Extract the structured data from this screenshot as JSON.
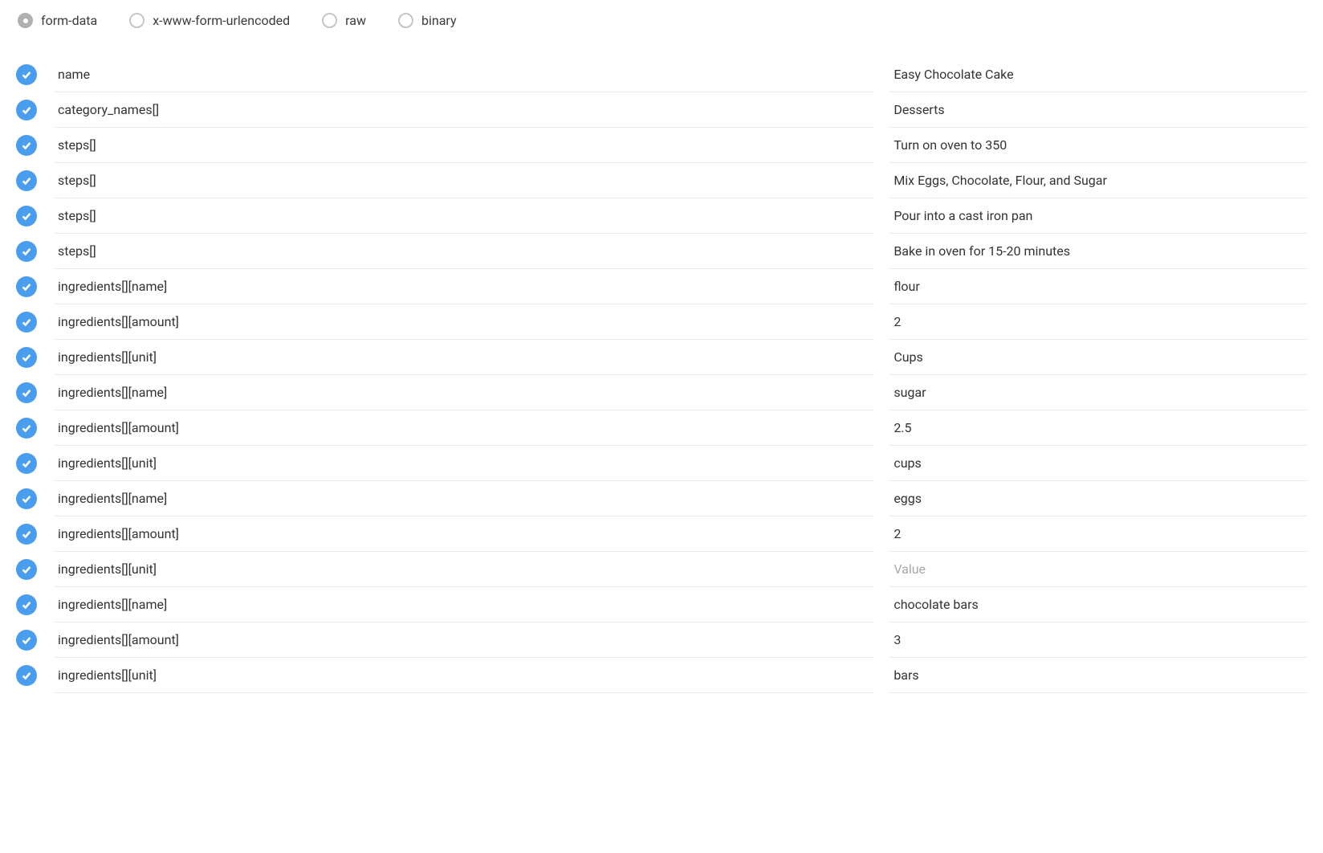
{
  "body_types": {
    "options": [
      {
        "label": "form-data",
        "selected": true
      },
      {
        "label": "x-www-form-urlencoded",
        "selected": false
      },
      {
        "label": "raw",
        "selected": false
      },
      {
        "label": "binary",
        "selected": false
      }
    ]
  },
  "placeholder_value": "Value",
  "rows": [
    {
      "checked": true,
      "key": "name",
      "value": "Easy Chocolate Cake",
      "is_placeholder": false
    },
    {
      "checked": true,
      "key": "category_names[]",
      "value": "Desserts",
      "is_placeholder": false
    },
    {
      "checked": true,
      "key": "steps[]",
      "value": "Turn on oven to 350",
      "is_placeholder": false
    },
    {
      "checked": true,
      "key": "steps[]",
      "value": "Mix Eggs, Chocolate, Flour, and Sugar",
      "is_placeholder": false
    },
    {
      "checked": true,
      "key": "steps[]",
      "value": "Pour into a cast iron pan",
      "is_placeholder": false
    },
    {
      "checked": true,
      "key": "steps[]",
      "value": "Bake in oven for 15-20 minutes",
      "is_placeholder": false
    },
    {
      "checked": true,
      "key": "ingredients[][name]",
      "value": "flour",
      "is_placeholder": false
    },
    {
      "checked": true,
      "key": "ingredients[][amount]",
      "value": "2",
      "is_placeholder": false
    },
    {
      "checked": true,
      "key": "ingredients[][unit]",
      "value": "Cups",
      "is_placeholder": false
    },
    {
      "checked": true,
      "key": "ingredients[][name]",
      "value": "sugar",
      "is_placeholder": false
    },
    {
      "checked": true,
      "key": "ingredients[][amount]",
      "value": "2.5",
      "is_placeholder": false
    },
    {
      "checked": true,
      "key": "ingredients[][unit]",
      "value": "cups",
      "is_placeholder": false
    },
    {
      "checked": true,
      "key": "ingredients[][name]",
      "value": "eggs",
      "is_placeholder": false
    },
    {
      "checked": true,
      "key": "ingredients[][amount]",
      "value": "2",
      "is_placeholder": false
    },
    {
      "checked": true,
      "key": "ingredients[][unit]",
      "value": "",
      "is_placeholder": true
    },
    {
      "checked": true,
      "key": "ingredients[][name]",
      "value": "chocolate bars",
      "is_placeholder": false
    },
    {
      "checked": true,
      "key": "ingredients[][amount]",
      "value": "3",
      "is_placeholder": false
    },
    {
      "checked": true,
      "key": "ingredients[][unit]",
      "value": "bars",
      "is_placeholder": false
    }
  ]
}
